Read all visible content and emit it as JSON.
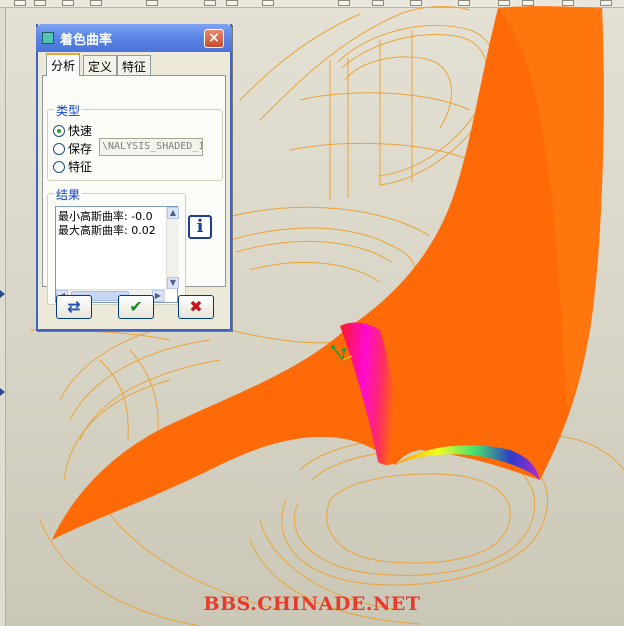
{
  "dialog": {
    "title": "着色曲率",
    "close_glyph": "×",
    "tabs": [
      {
        "label": "分析",
        "active": true
      },
      {
        "label": "定义",
        "active": false
      },
      {
        "label": "特征",
        "active": false
      }
    ],
    "type_group": {
      "label": "类型",
      "options": [
        {
          "label": "快速",
          "selected": true
        },
        {
          "label": "保存",
          "selected": false
        },
        {
          "label": "特征",
          "selected": false
        }
      ],
      "name_value": "\\NALYSIS_SHADED_1"
    },
    "results_group": {
      "label": "结果",
      "lines": [
        "最小高斯曲率: -0.0",
        "最大高斯曲率: 0.02"
      ]
    },
    "scroll": {
      "up": "▲",
      "down": "▼",
      "left": "◀",
      "right": "▶"
    },
    "info_glyph": "i",
    "buttons": {
      "repeat_glyph": "⇄",
      "ok_glyph": "✔",
      "cancel_glyph": "✖"
    }
  },
  "watermark": "BBS.CHINADE.NET",
  "colors": {
    "surface_orange": "#ff6a08",
    "wireframe": "#e8a338",
    "dialog_title_blue": "#5a85e6",
    "ok_green": "#1a8a2a",
    "cancel_red": "#c8171c",
    "watermark_red": "#e8392a"
  }
}
